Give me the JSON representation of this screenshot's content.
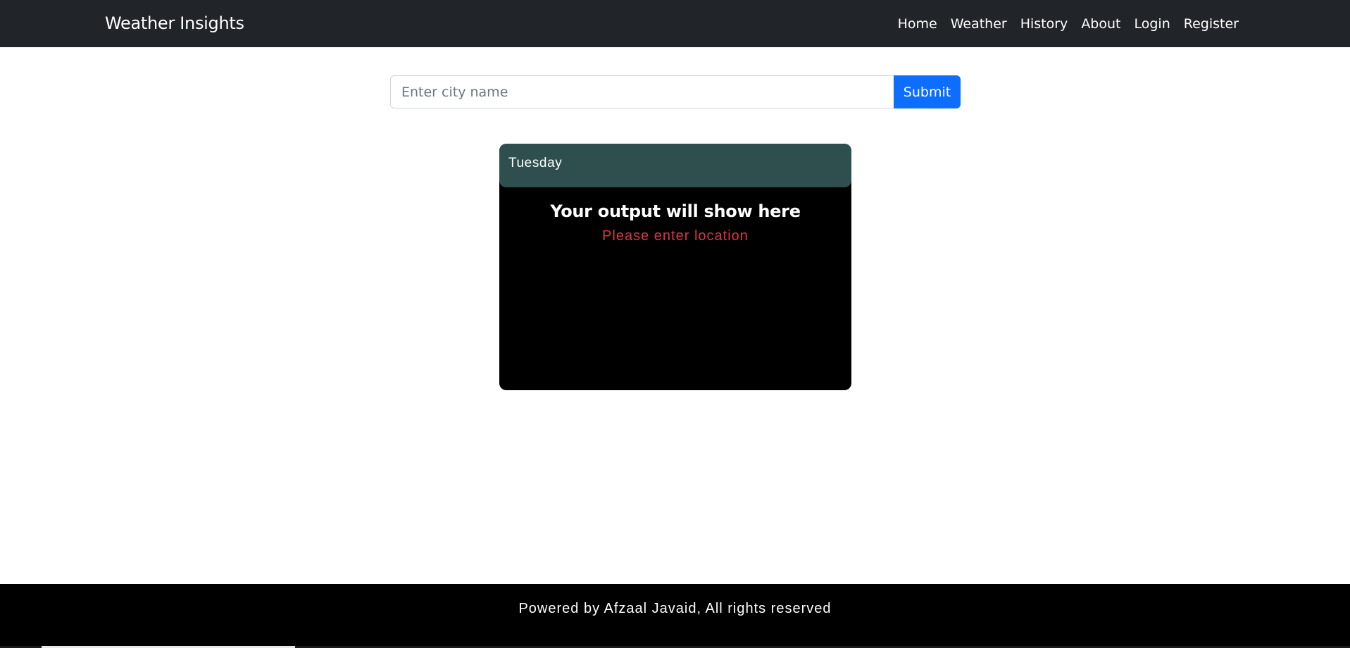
{
  "navbar": {
    "brand": "Weather Insights",
    "links": [
      "Home",
      "Weather",
      "History",
      "About",
      "Login",
      "Register"
    ]
  },
  "search": {
    "placeholder": "Enter city name",
    "value": "",
    "submit_label": "Submit"
  },
  "card": {
    "day": "Tuesday",
    "title": "Your output will show here",
    "message": "Please enter location"
  },
  "footer": {
    "text": "Powered by Afzaal Javaid, All rights reserved"
  },
  "colors": {
    "navbar_bg": "#212529",
    "submit_bg": "#0d6efd",
    "card_header_bg": "#2f4f4f",
    "card_bg": "#000000",
    "message_color": "#dc3545",
    "footer_bg": "#000000"
  }
}
